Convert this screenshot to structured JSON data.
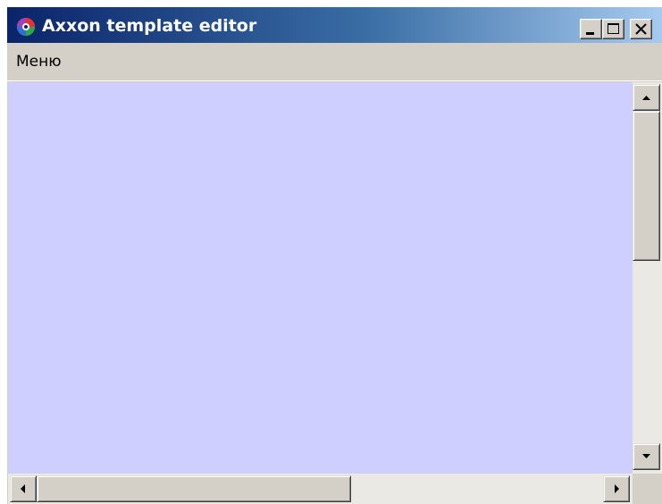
{
  "window": {
    "title": "Axxon template editor",
    "app_icon": "axxon-logo-icon",
    "caption_buttons": [
      "minimize-icon",
      "maximize-icon",
      "close-icon"
    ]
  },
  "menu": {
    "items": [
      {
        "label": "Меню"
      }
    ]
  },
  "canvas": {
    "background_color": "#cfcfff"
  },
  "scrollbars": {
    "vertical": {
      "up_icon": "arrow-up-icon",
      "down_icon": "arrow-down-icon"
    },
    "horizontal": {
      "left_icon": "arrow-left-icon",
      "right_icon": "arrow-right-icon"
    }
  },
  "colors": {
    "titlebar_start": "#0a246a",
    "titlebar_end": "#a6caf0",
    "chrome": "#d4d0c8"
  }
}
